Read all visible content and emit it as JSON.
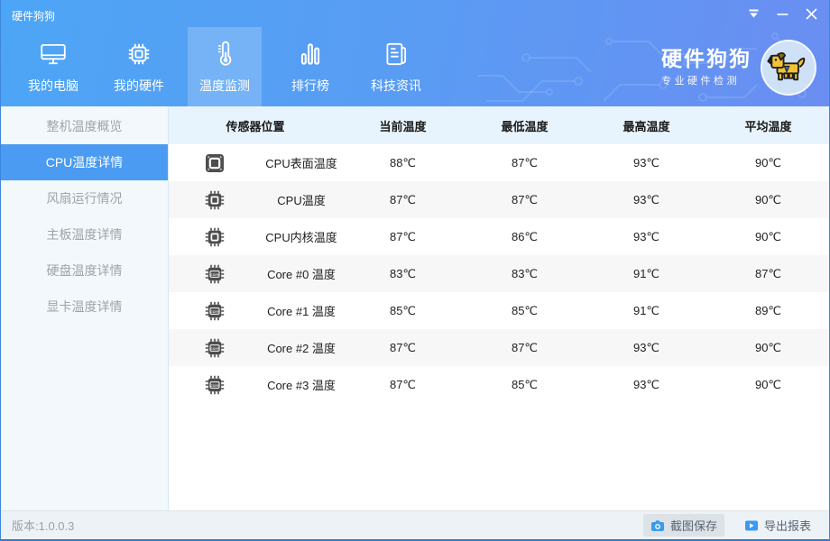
{
  "window": {
    "title": "硬件狗狗"
  },
  "titlebar": {
    "controls": [
      "menu-dropdown",
      "minimize",
      "close"
    ]
  },
  "nav": {
    "active_index": 2,
    "tabs": [
      {
        "label": "我的电脑",
        "icon": "computer-icon"
      },
      {
        "label": "我的硬件",
        "icon": "chip-icon"
      },
      {
        "label": "温度监测",
        "icon": "thermometer-icon"
      },
      {
        "label": "排行榜",
        "icon": "bar-chart-icon"
      },
      {
        "label": "科技资讯",
        "icon": "news-icon"
      }
    ]
  },
  "brand": {
    "name": "硬件狗狗",
    "tagline": "专业硬件检测",
    "logo": "dog-logo"
  },
  "sidebar": {
    "active_index": 1,
    "items": [
      "整机温度概览",
      "CPU温度详情",
      "风扇运行情况",
      "主板温度详情",
      "硬盘温度详情",
      "显卡温度详情"
    ]
  },
  "table": {
    "headers": [
      "传感器位置",
      "当前温度",
      "最低温度",
      "最高温度",
      "平均温度"
    ],
    "rows": [
      {
        "icon": "cpu-surface-icon",
        "name": "CPU表面温度",
        "current": "88℃",
        "min": "87℃",
        "max": "93℃",
        "avg": "90℃"
      },
      {
        "icon": "cpu-chip-icon",
        "name": "CPU温度",
        "current": "87℃",
        "min": "87℃",
        "max": "93℃",
        "avg": "90℃"
      },
      {
        "icon": "cpu-chip-icon",
        "name": "CPU内核温度",
        "current": "87℃",
        "min": "86℃",
        "max": "93℃",
        "avg": "90℃"
      },
      {
        "icon": "cpu-core-icon",
        "name": "Core #0 温度",
        "current": "83℃",
        "min": "83℃",
        "max": "91℃",
        "avg": "87℃"
      },
      {
        "icon": "cpu-core-icon",
        "name": "Core #1 温度",
        "current": "85℃",
        "min": "85℃",
        "max": "91℃",
        "avg": "89℃"
      },
      {
        "icon": "cpu-core-icon",
        "name": "Core #2 温度",
        "current": "87℃",
        "min": "87℃",
        "max": "93℃",
        "avg": "90℃"
      },
      {
        "icon": "cpu-core-icon",
        "name": "Core #3 温度",
        "current": "87℃",
        "min": "85℃",
        "max": "93℃",
        "avg": "90℃"
      }
    ]
  },
  "footer": {
    "version": "版本:1.0.0.3",
    "screenshot_label": "截图保存",
    "export_label": "导出报表"
  },
  "colors": {
    "header_gradient_left": "#4da5f5",
    "header_gradient_right": "#6a8ef2",
    "sidebar_active": "#4a9bf1",
    "table_header_bg": "#e8f4fd",
    "row_stripe": "#f7f7f8",
    "accent_blue": "#3a9bee"
  }
}
